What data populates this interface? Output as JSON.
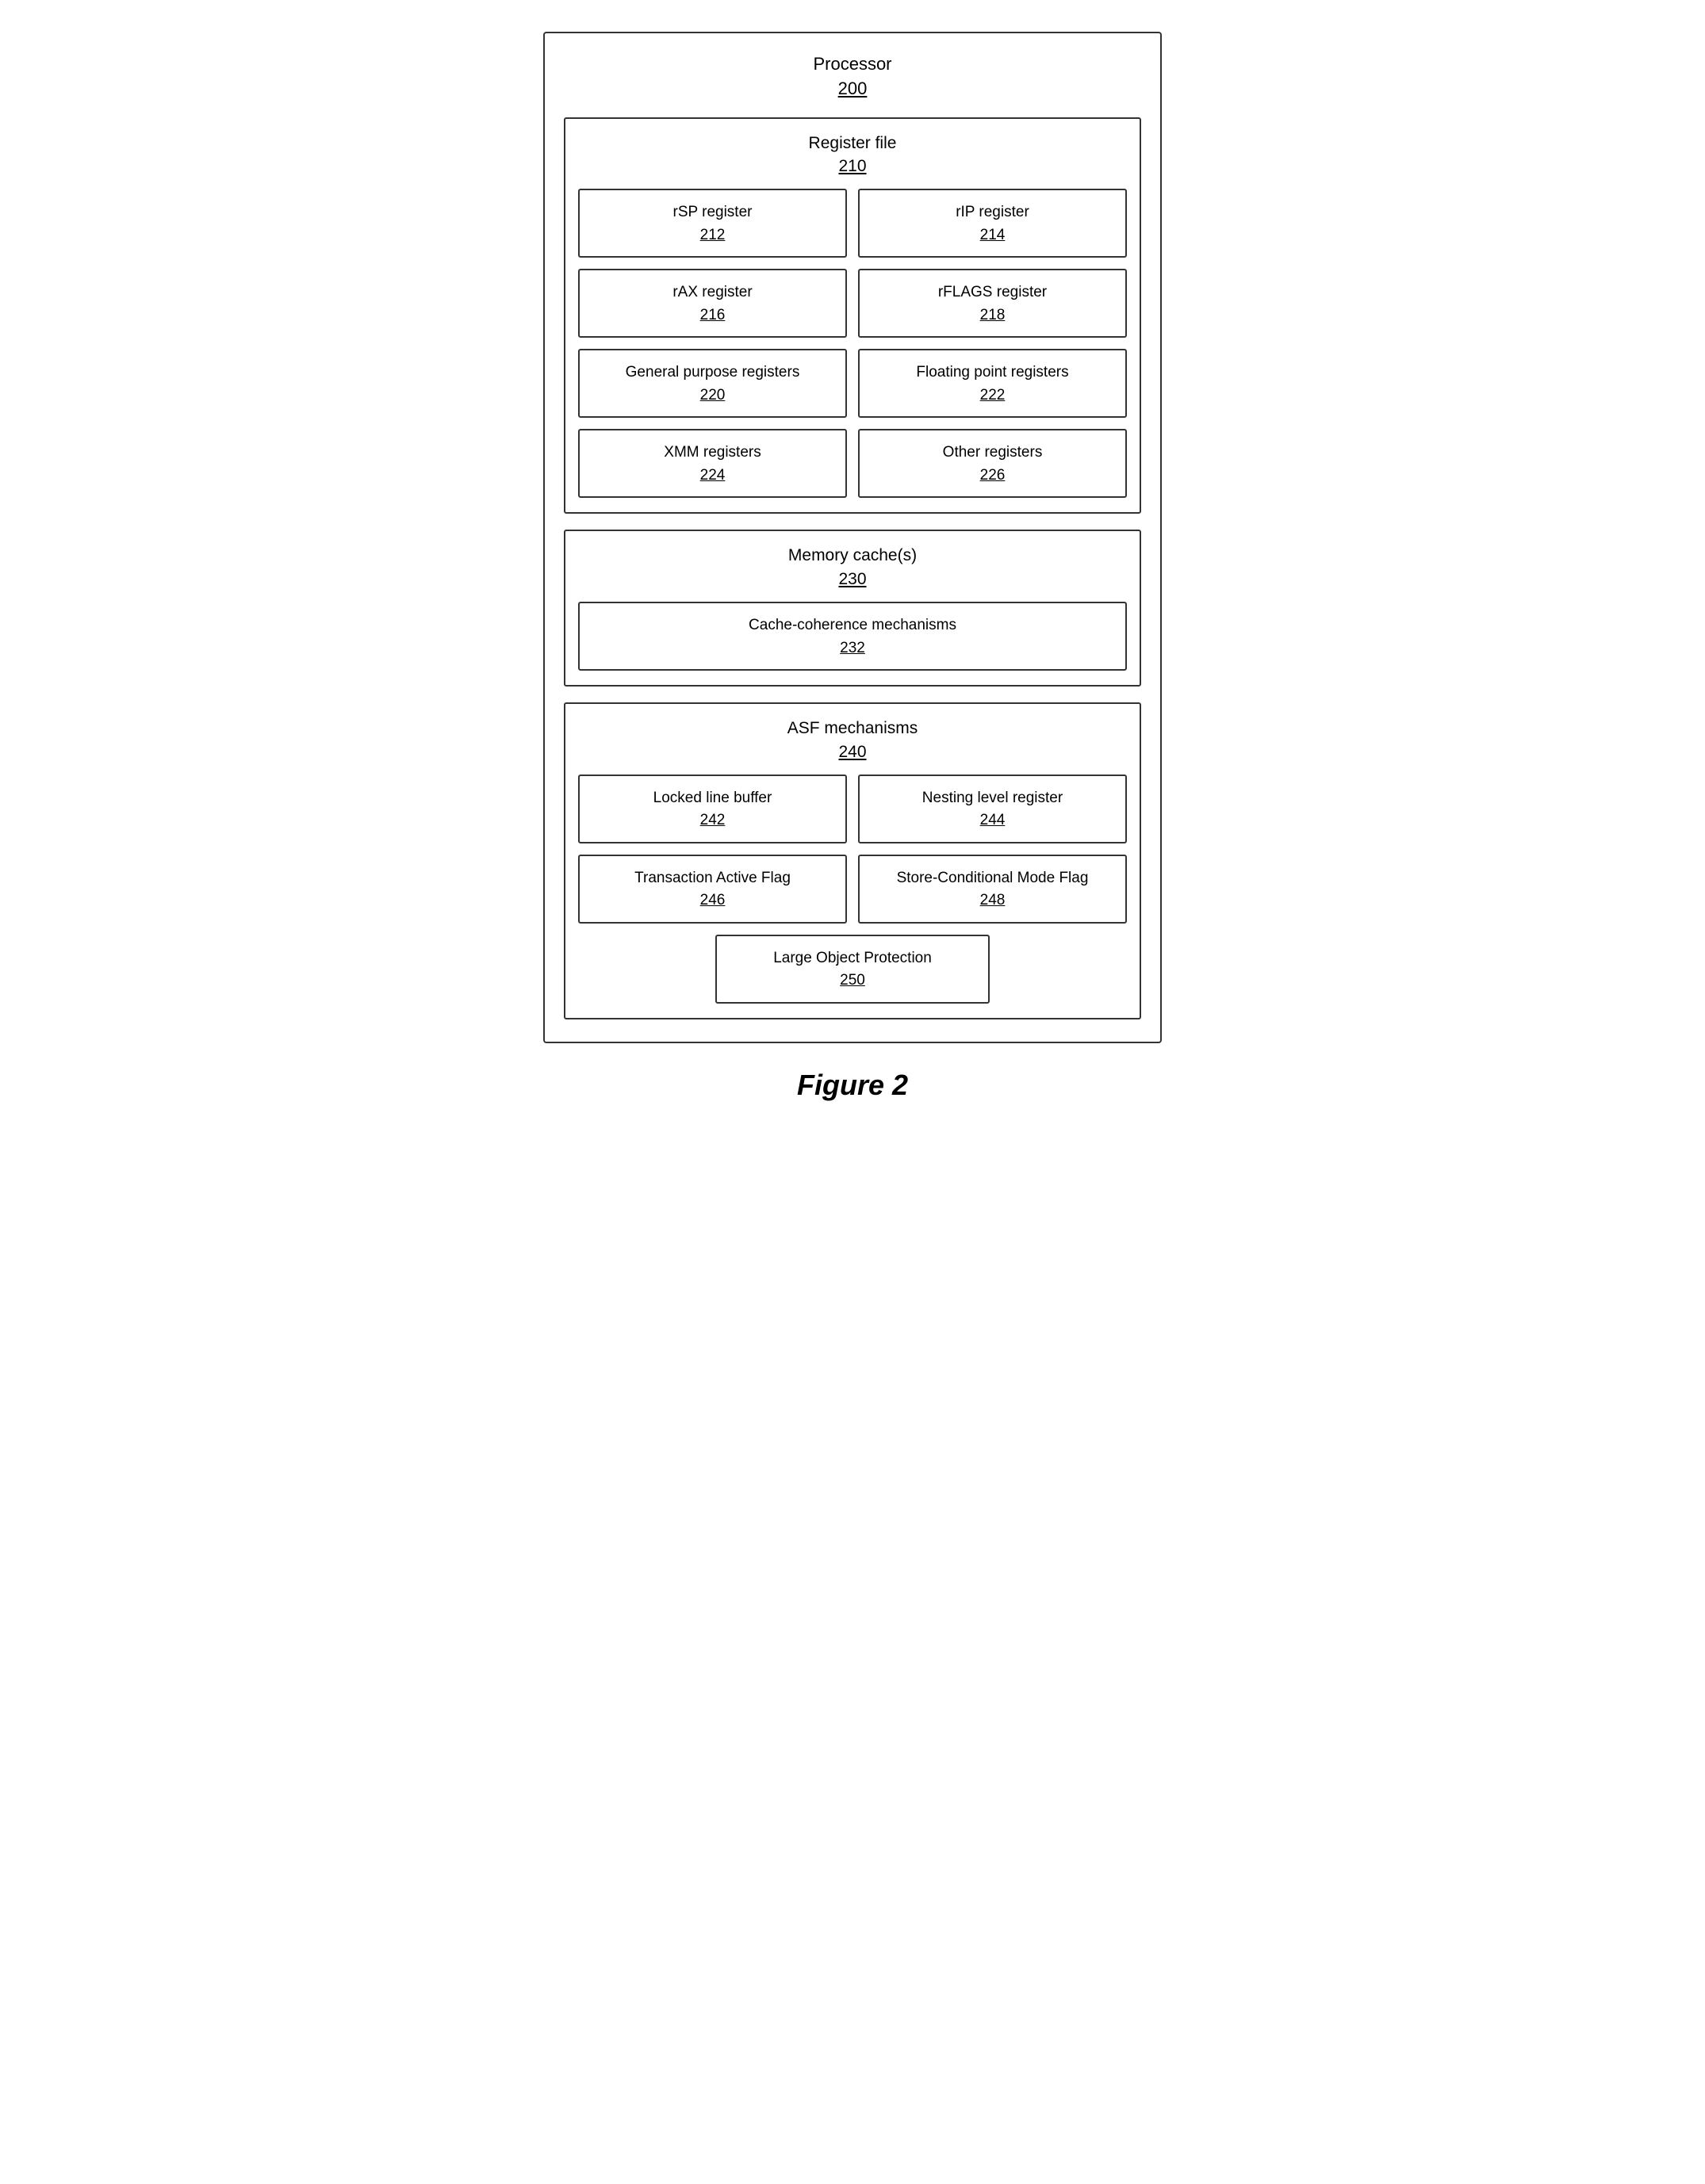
{
  "processor": {
    "label": "Processor",
    "number": "200"
  },
  "register_file": {
    "label": "Register file",
    "number": "210",
    "cells": [
      {
        "label": "rSP register",
        "number": "212"
      },
      {
        "label": "rIP register",
        "number": "214"
      },
      {
        "label": "rAX register",
        "number": "216"
      },
      {
        "label": "rFLAGS register",
        "number": "218"
      },
      {
        "label": "General purpose registers",
        "number": "220"
      },
      {
        "label": "Floating point registers",
        "number": "222"
      },
      {
        "label": "XMM registers",
        "number": "224"
      },
      {
        "label": "Other registers",
        "number": "226"
      }
    ]
  },
  "memory_cache": {
    "label": "Memory cache(s)",
    "number": "230",
    "inner_label": "Cache-coherence mechanisms",
    "inner_number": "232"
  },
  "asf_mechanisms": {
    "label": "ASF mechanisms",
    "number": "240",
    "cells": [
      {
        "label": "Locked line buffer",
        "number": "242"
      },
      {
        "label": "Nesting level register",
        "number": "244"
      },
      {
        "label": "Transaction Active Flag",
        "number": "246"
      },
      {
        "label": "Store-Conditional Mode Flag",
        "number": "248"
      }
    ],
    "center_cell": {
      "label": "Large Object Protection",
      "number": "250"
    }
  },
  "figure": {
    "label": "Figure 2"
  }
}
